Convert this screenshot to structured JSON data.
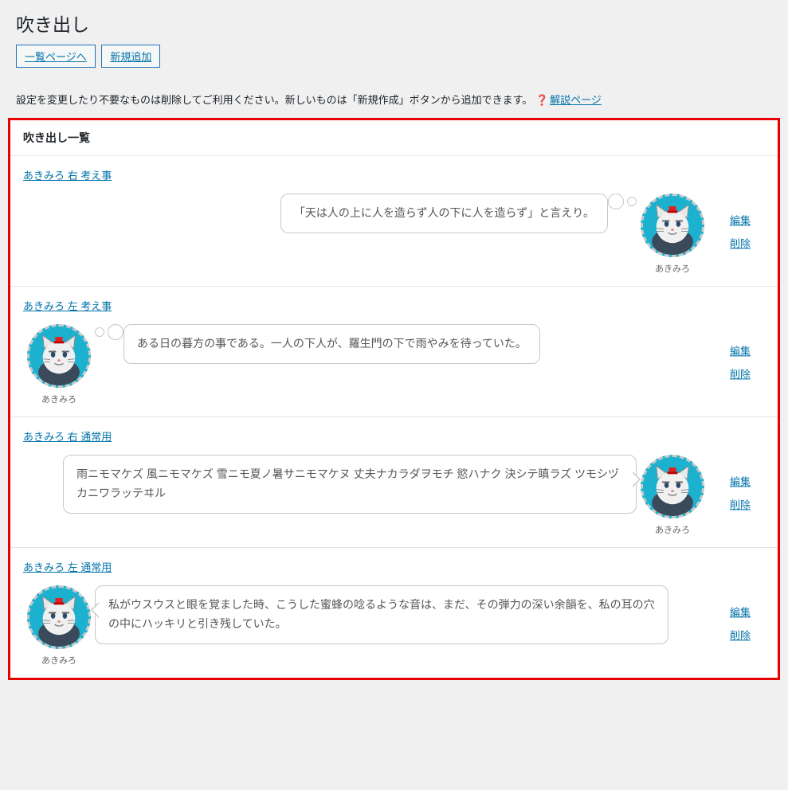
{
  "page": {
    "title": "吹き出し",
    "list_button": "一覧ページへ",
    "add_button": "新規追加",
    "description": "設定を変更したり不要なものは削除してご利用ください。新しいものは「新規作成」ボタンから追加できます。",
    "help_link": "解説ページ",
    "list_heading": "吹き出し一覧"
  },
  "actions": {
    "edit": "編集",
    "delete": "削除"
  },
  "avatar_name": "あきみろ",
  "items": [
    {
      "title": "あきみろ 右 考え事",
      "text": "「天は人の上に人を造らず人の下に人を造らず」と言えり。",
      "side": "right",
      "style": "think"
    },
    {
      "title": "あきみろ 左 考え事",
      "text": "ある日の暮方の事である。一人の下人が、羅生門の下で雨やみを待っていた。",
      "side": "left",
      "style": "think"
    },
    {
      "title": "あきみろ 右 通常用",
      "text": "雨ニモマケズ 風ニモマケズ 雪ニモ夏ノ暑サニモマケヌ 丈夫ナカラダヲモチ 慾ハナク 決シテ瞋ラズ ツモシヅカニワラッテヰル",
      "side": "right",
      "style": "speech",
      "wide": true
    },
    {
      "title": "あきみろ 左 通常用",
      "text": "私がウスウスと眼を覚ました時、こうした蜜蜂の唸るような音は、まだ、その弾力の深い余韻を、私の耳の穴の中にハッキリと引き残していた。",
      "side": "left",
      "style": "speech",
      "wide": true
    }
  ]
}
